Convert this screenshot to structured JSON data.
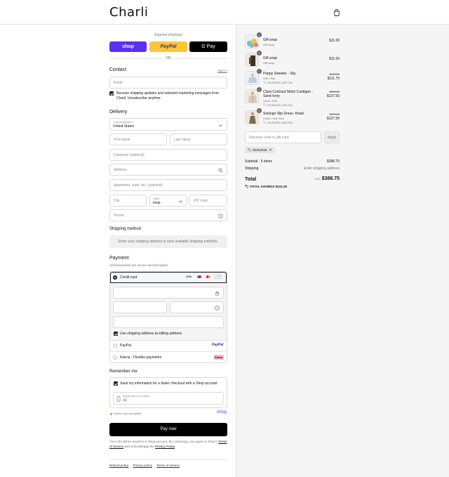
{
  "header": {
    "logo": "Charli",
    "bag_icon": "shopping-bag-icon"
  },
  "express": {
    "title": "Express checkout",
    "shop_label": "shop",
    "paypal_label": "PayPal",
    "gpay_label": "G Pay",
    "or_label": "OR"
  },
  "contact": {
    "heading": "Contact",
    "sign_in": "Sign in",
    "email_placeholder": "Email",
    "marketing_text": "Receive shipping updates and selected marketing messages from Charli. Unsubscribe anytime."
  },
  "delivery": {
    "heading": "Delivery",
    "country_label": "Country/Region",
    "country_value": "United States",
    "first_name": "First name",
    "last_name": "Last name",
    "company": "Company (optional)",
    "address": "Address",
    "apartment": "Apartment, suite, etc. (optional)",
    "city": "City",
    "state_label": "State",
    "state_value": "Iowa",
    "zip": "ZIP code",
    "phone": "Phone"
  },
  "shipping": {
    "heading": "Shipping method",
    "notice": "Enter your shipping address to view available shipping methods."
  },
  "payment": {
    "heading": "Payment",
    "subtitle": "All transactions are secure and encrypted.",
    "credit_card": "Credit card",
    "card_badges": [
      "VISA",
      "MC",
      "MC",
      "+3"
    ],
    "billing_same": "Use shipping address as billing address",
    "paypal": "PayPal",
    "paypal_badge": "PayPal",
    "klarna": "Klarna - Flexible payments",
    "klarna_badge": "Klarna."
  },
  "remember": {
    "heading": "Remember me",
    "save_text": "Save my information for a faster checkout with a Shop account",
    "phone_label": "Mobile phone number",
    "phone_value": "+1",
    "secure_text": "Secure and encrypted",
    "shop_logo": "shop"
  },
  "pay_now": "Pay now",
  "legal": {
    "text": "Your info will be saved to a Shop account. By continuing, you agree to Shop's",
    "terms": "Terms of Service",
    "and_text": "and acknowledge the",
    "privacy": "Privacy Policy",
    "period": "."
  },
  "footer": {
    "refund": "Refund policy",
    "privacy": "Privacy policy",
    "terms": "Terms of service"
  },
  "summary": {
    "items": [
      {
        "qty": "1",
        "name": "Gift wrap",
        "variant": "Gift wrap",
        "discount": "",
        "old_price": "",
        "price": "$11.00"
      },
      {
        "qty": "1",
        "name": "Gift wrap",
        "variant": "Gift wrap",
        "discount": "",
        "old_price": "",
        "price": "$11.00"
      },
      {
        "qty": "1",
        "name": "Poppy Sweater - Sky",
        "variant": "S/M / Sky",
        "discount": "25JN2025 (-$37.25)",
        "old_price": "$149.00",
        "price": "$111.75"
      },
      {
        "qty": "1",
        "name": "Clara Contrast Stitch Cardigan - Sand Ivory",
        "variant": "Sand / S/M",
        "discount": "25JN2025 (-$42.50)",
        "old_price": "$170.00",
        "price": "$127.50"
      },
      {
        "qty": "1",
        "name": "Solange Slip Dress- Khaki",
        "variant": "Khaki / One Size",
        "discount": "25JN2025 (-$42.50)",
        "old_price": "$170.00",
        "price": "$127.50"
      }
    ],
    "discount_placeholder": "Discount code or gift card",
    "apply": "Apply",
    "applied_code": "25JN2025",
    "subtotal_label": "Subtotal · 5 items",
    "subtotal_value": "$388.75",
    "shipping_label": "Shipping",
    "shipping_value": "Enter shipping address",
    "total_label": "Total",
    "currency": "USD",
    "total_value": "$388.75",
    "savings_label": "TOTAL SAVINGS",
    "savings_value": "$122.25"
  },
  "colors": {
    "shop_purple": "#5a31f4",
    "paypal_yellow": "#ffc439",
    "black": "#000000",
    "klarna_pink": "#ffb3c7"
  }
}
